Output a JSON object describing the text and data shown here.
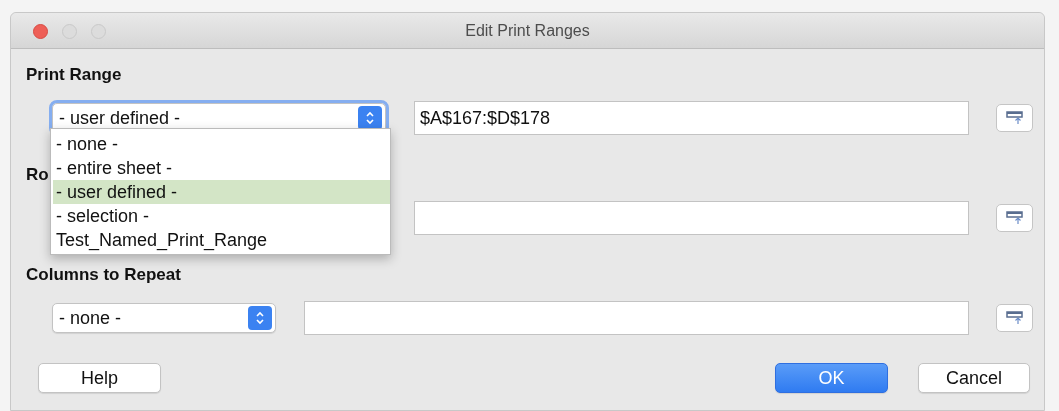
{
  "window": {
    "title": "Edit Print Ranges"
  },
  "sections": [
    {
      "label": "Print Range",
      "dropdown": {
        "value": "- user defined -",
        "open": true,
        "options": [
          {
            "label": "- none -",
            "selected": false
          },
          {
            "label": "- entire sheet -",
            "selected": false
          },
          {
            "label": "- user defined -",
            "selected": true
          },
          {
            "label": "- selection -",
            "selected": false
          },
          {
            "label": "Test_Named_Print_Range",
            "selected": false
          }
        ]
      },
      "field": {
        "value": "$A$167:$D$178"
      }
    },
    {
      "label": "Ro"
    },
    {
      "label": "Columns to Repeat",
      "dropdown": {
        "value": "- none -",
        "open": false
      }
    }
  ],
  "buttons": [
    {
      "label": "Help",
      "kind": "default"
    },
    {
      "label": "OK",
      "kind": "primary"
    },
    {
      "label": "Cancel",
      "kind": "default"
    }
  ]
}
